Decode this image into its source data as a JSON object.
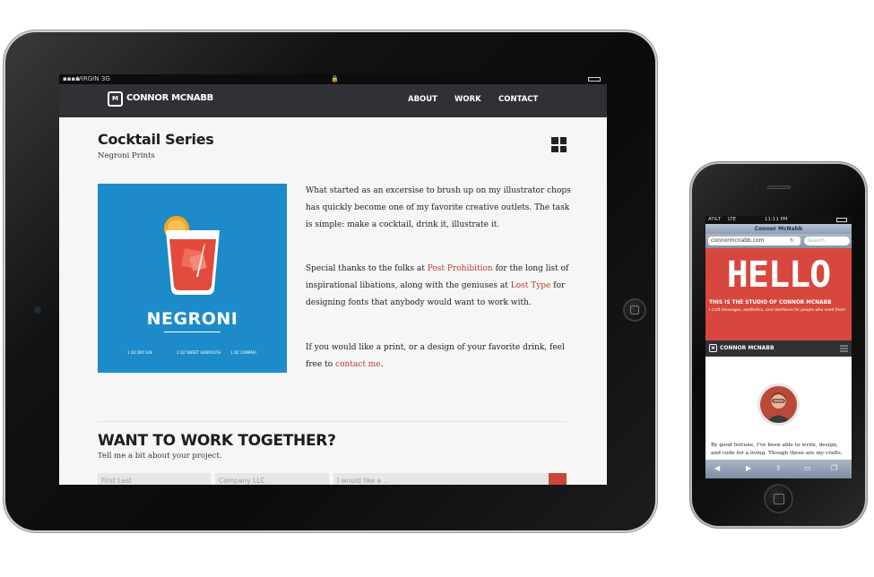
{
  "ipad": {
    "status": {
      "carrier": "VIRGIN",
      "network": "3G"
    },
    "nav": {
      "logo_mark": "M",
      "brand": "CONNOR MCNABB",
      "links": [
        "ABOUT",
        "WORK",
        "CONTACT"
      ]
    },
    "project": {
      "title": "Cocktail Series",
      "subtitle": "Negroni Prints",
      "poster": {
        "title": "NEGRONI",
        "ingredients": [
          "1 OZ DRY GIN",
          "1 OZ SWEET VERMOUTH",
          "1 OZ CAMPARI"
        ]
      },
      "paragraphs": {
        "p1": "What started as an excersise to brush up on my illustrator chops has quickly become one of my favorite creative outlets. The task is simple: make a cocktail, drink it, illustrate it.",
        "p2_a": "Special thanks to the folks at ",
        "p2_link1": "Post Prohibition",
        "p2_b": " for the long list of inspirational libations, along with the geniuses at ",
        "p2_link2": "Lost Type",
        "p2_c": " for designing fonts that anybody would want to work with.",
        "p3_a": "If you would like a print, or a design of your favorite drink, feel free to ",
        "p3_link": "contact me",
        "p3_b": "."
      }
    },
    "contact": {
      "heading": "WANT TO WORK TOGETHER?",
      "subheading": "Tell me a bit about your project.",
      "fields": [
        "First Last",
        "Company LLC",
        "I would like a ..."
      ]
    }
  },
  "iphone": {
    "status": {
      "carrier": "AT&T",
      "network": "LTE",
      "time": "11:11 PM"
    },
    "browser": {
      "page_title": "Connor McNabb",
      "url": "connormcnabb.com",
      "search_placeholder": "Search"
    },
    "hero": {
      "title": "HELLO",
      "studio": "THIS IS THE STUDIO OF CONNOR MCNABB",
      "tagline": "I craft messages, aesthetics, and interfaces for people who need them."
    },
    "nav": {
      "logo_mark": "M",
      "brand": "CONNOR MCNABB"
    },
    "body": "By good fortune, I've been able to write, design, and code for a living. Though these are my crafts, my"
  },
  "colors": {
    "nav_bg": "#2f3136",
    "poster_blue": "#1d8bc9",
    "link_red": "#c0392b",
    "hero_red": "#d8473d"
  }
}
